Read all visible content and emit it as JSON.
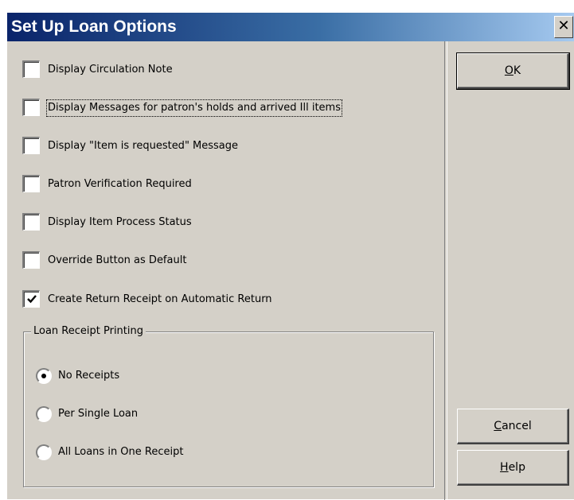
{
  "window": {
    "title": "Set Up Loan Options",
    "close_glyph": "✕"
  },
  "options": [
    {
      "label": "Display Circulation Note",
      "checked": false
    },
    {
      "label": "Display Messages for patron's holds and arrived Ill items",
      "checked": false
    },
    {
      "label": "Display \"Item is requested\" Message",
      "checked": false
    },
    {
      "label": "Patron Verification Required",
      "checked": false
    },
    {
      "label": "Display Item Process Status",
      "checked": false
    },
    {
      "label": "Override Button as Default",
      "checked": false
    },
    {
      "label": "Create Return Receipt on Automatic Return",
      "checked": true
    }
  ],
  "receipt_group": {
    "legend": "Loan Receipt Printing",
    "radios": [
      {
        "label": "No Receipts",
        "selected": true
      },
      {
        "label": "Per Single Loan",
        "selected": false
      },
      {
        "label": "All Loans in One Receipt",
        "selected": false
      }
    ]
  },
  "buttons": {
    "ok": {
      "accel": "O",
      "rest": "K"
    },
    "cancel": {
      "accel": "C",
      "rest": "ancel"
    },
    "help": {
      "accel": "H",
      "rest": "elp"
    }
  }
}
